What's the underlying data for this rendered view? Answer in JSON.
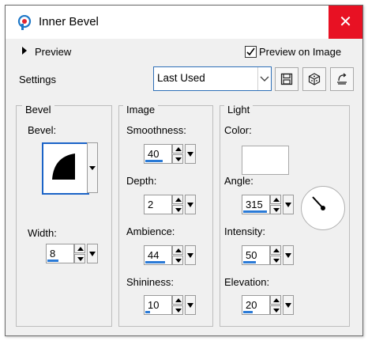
{
  "window": {
    "title": "Inner Bevel",
    "close_glyph": "✕",
    "close_color": "#e81123"
  },
  "preview_toggle": {
    "label": "Preview"
  },
  "preview_on_image": {
    "label": "Preview on Image",
    "checked": true
  },
  "settings": {
    "label": "Settings",
    "preset": "Last Used"
  },
  "toolbar_icons": [
    "save-preset-icon",
    "randomize-dice-icon",
    "reset-icon"
  ],
  "bevel_group": {
    "title": "Bevel",
    "bevel_label": "Bevel:",
    "width_label": "Width:",
    "width_value": "8"
  },
  "image_group": {
    "title": "Image",
    "smoothness_label": "Smoothness:",
    "smoothness_value": "40",
    "depth_label": "Depth:",
    "depth_value": "2",
    "ambience_label": "Ambience:",
    "ambience_value": "44",
    "shininess_label": "Shininess:",
    "shininess_value": "10"
  },
  "light_group": {
    "title": "Light",
    "color_label": "Color:",
    "color_value": "#ffffff",
    "angle_label": "Angle:",
    "angle_value": "315",
    "intensity_label": "Intensity:",
    "intensity_value": "50",
    "elevation_label": "Elevation:",
    "elevation_value": "20"
  },
  "accent_color": "#2a7ad6"
}
